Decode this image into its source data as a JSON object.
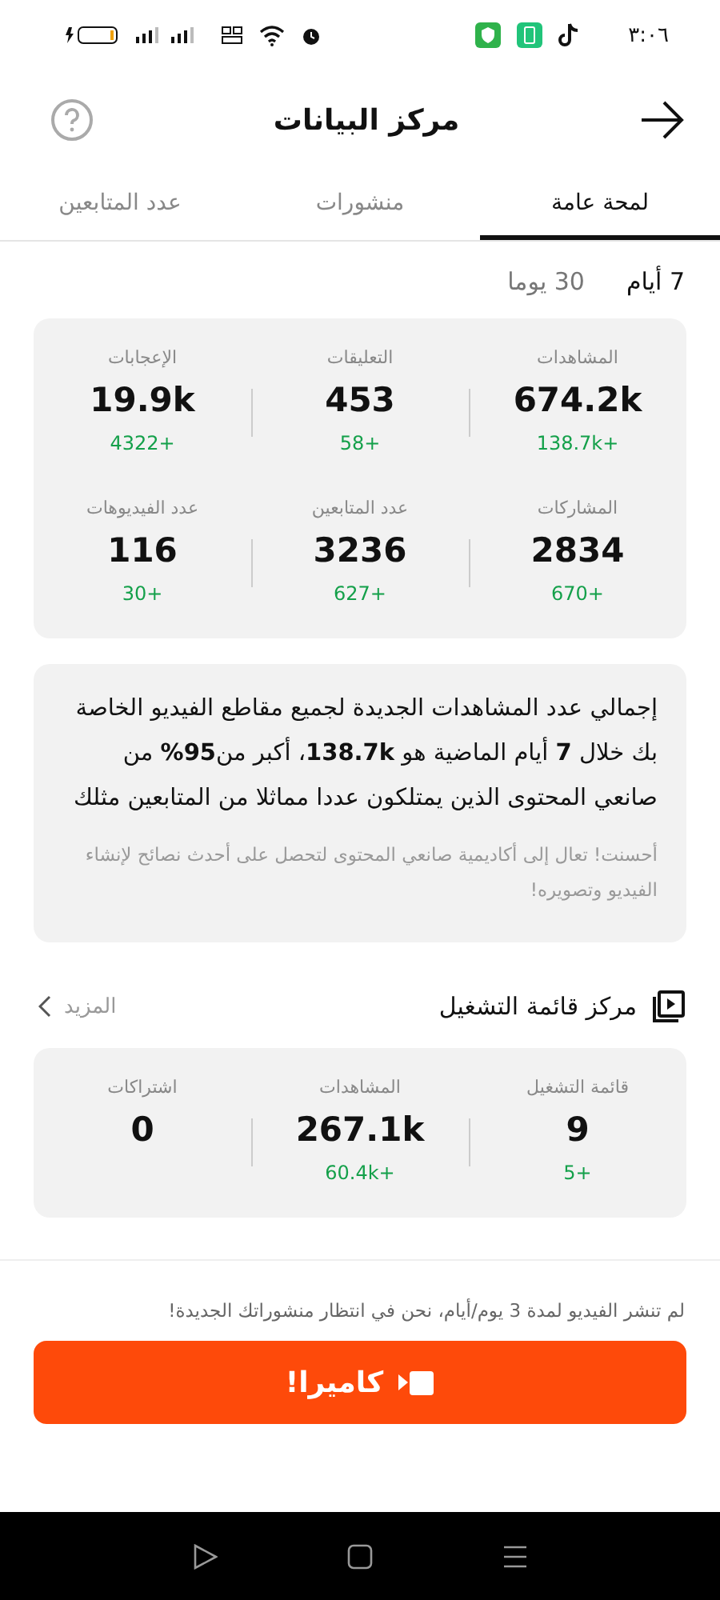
{
  "status_bar": {
    "time": "٣:٠٦"
  },
  "header": {
    "title": "مركز البيانات"
  },
  "tabs": [
    {
      "label": "لمحة عامة",
      "selected": true
    },
    {
      "label": "منشورات",
      "selected": false
    },
    {
      "label": "عدد المتابعين",
      "selected": false
    }
  ],
  "periods": [
    {
      "label": "7 أيام",
      "selected": true
    },
    {
      "label": "30 يوما",
      "selected": false
    }
  ],
  "stats": [
    {
      "label": "المشاهدات",
      "value": "674.2k",
      "change": "138.7k+"
    },
    {
      "label": "التعليقات",
      "value": "453",
      "change": "58+"
    },
    {
      "label": "الإعجابات",
      "value": "19.9k",
      "change": "4322+"
    },
    {
      "label": "المشاركات",
      "value": "2834",
      "change": "670+"
    },
    {
      "label": "عدد المتابعين",
      "value": "3236",
      "change": "627+"
    },
    {
      "label": "عدد الفيديوهات",
      "value": "116",
      "change": "30+"
    }
  ],
  "insight": {
    "text": "إجمالي عدد المشاهدات الجديدة لجميع مقاطع الفيديو الخاصة بك خلال **7** أيام الماضية هو **138.7k**، أكبر من**95%** من صانعي المحتوى الذين يمتلكون عددا مماثلا من المتابعين مثلك",
    "tip": "أحسنت! تعال إلى أكاديمية صانعي المحتوى لتحصل على أحدث نصائح لإنشاء الفيديو وتصويره!"
  },
  "playlist": {
    "title": "مركز قائمة التشغيل",
    "more": "المزيد",
    "stats": [
      {
        "label": "قائمة التشغيل",
        "value": "9",
        "change": "5+"
      },
      {
        "label": "المشاهدات",
        "value": "267.1k",
        "change": "60.4k+"
      },
      {
        "label": "اشتراكات",
        "value": "0"
      }
    ]
  },
  "notice": "لم تنشر الفيديو لمدة 3 يوم/أيام، نحن في انتظار منشوراتك الجديدة!",
  "camera_button": "كاميرا!"
}
